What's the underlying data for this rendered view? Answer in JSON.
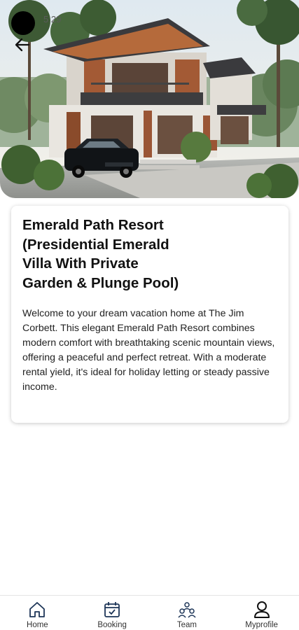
{
  "status_bar": {
    "time": "5:29"
  },
  "hero": {
    "image_subject": "modern-villa-photo"
  },
  "property": {
    "title": "Emerald Path Resort (Presidential Emerald Villa With Private Garden & Plunge Pool)",
    "description": "Welcome to your dream vacation home at The Jim Corbett. This elegant Emerald Path Resort combines modern comfort with breathtaking scenic mountain views, offering a peaceful and perfect retreat. With a moderate rental yield, it's ideal for holiday letting or steady passive income."
  },
  "nav": {
    "items": [
      {
        "label": "Home",
        "icon": "home-icon"
      },
      {
        "label": "Booking",
        "icon": "calendar-check-icon"
      },
      {
        "label": "Team",
        "icon": "team-icon"
      },
      {
        "label": "Myprofile",
        "icon": "profile-icon"
      }
    ]
  },
  "colors": {
    "nav_icon": "#1d3557",
    "text": "#111111",
    "card_shadow": "#cccccc"
  }
}
